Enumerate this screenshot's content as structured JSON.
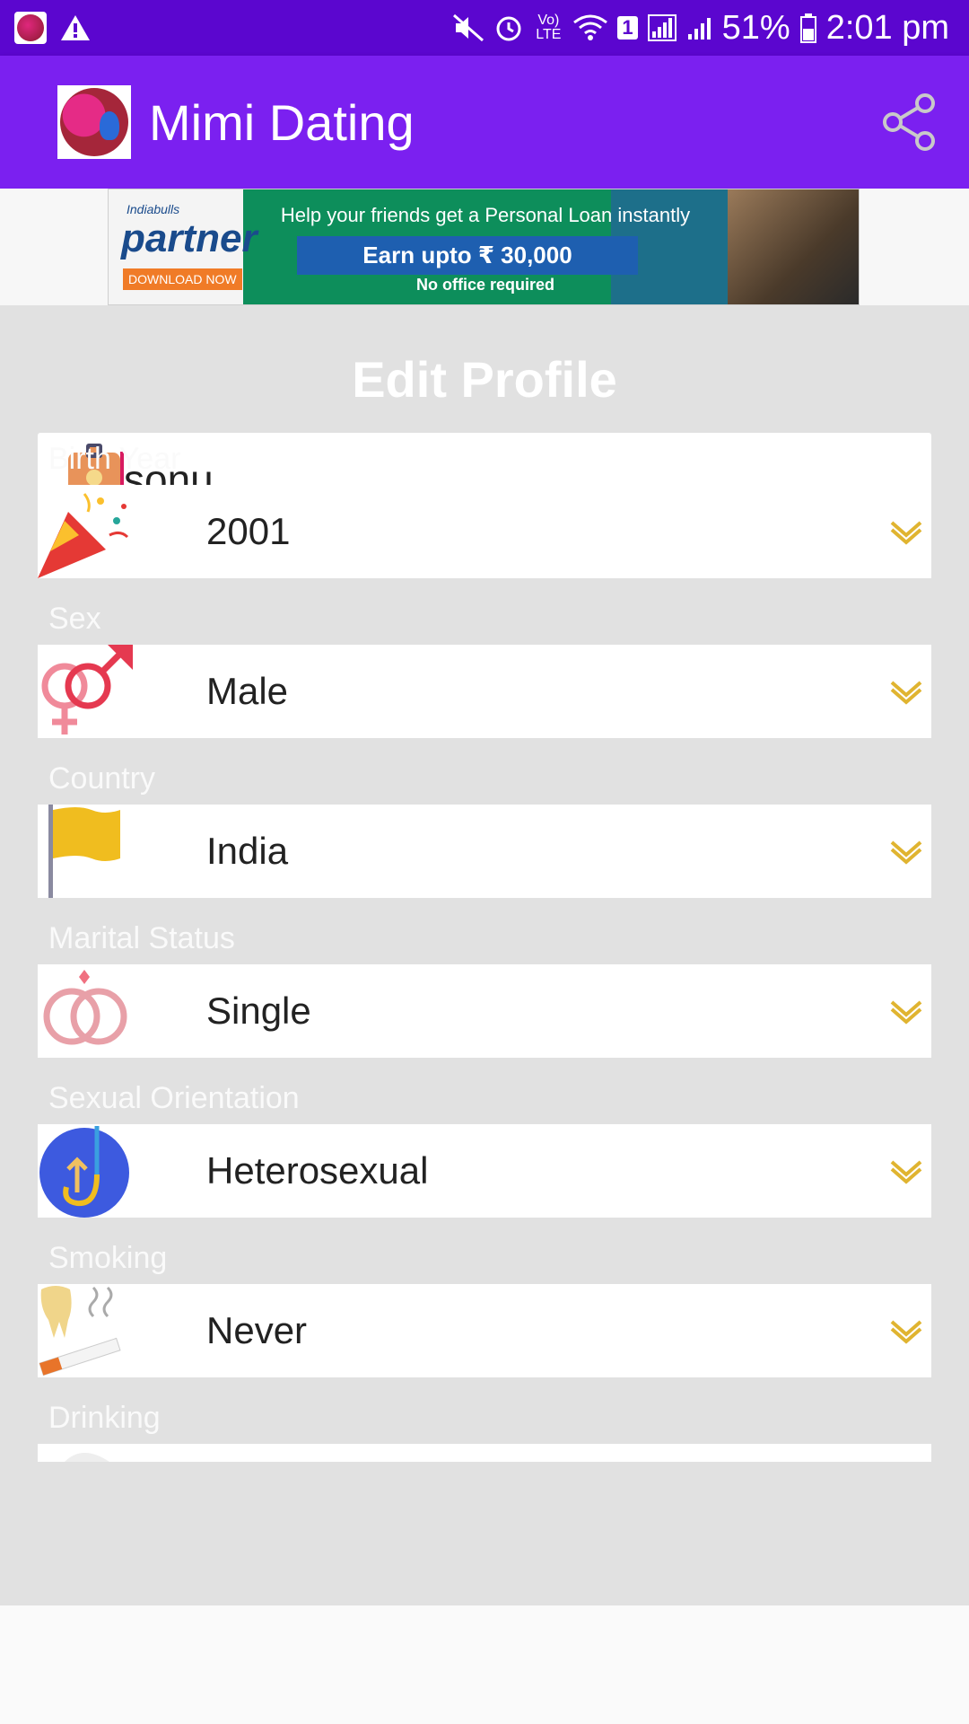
{
  "status_bar": {
    "battery": "51%",
    "time": "2:01 pm",
    "volte": "Vo) LTE",
    "sim": "1"
  },
  "app_bar": {
    "title": "Mimi Dating"
  },
  "ad": {
    "brand_small": "Indiabulls",
    "brand": "partner",
    "cta": "DOWNLOAD NOW",
    "line1": "Help your friends get a Personal Loan instantly",
    "line2": "Earn upto ₹ 30,000",
    "line3": "No office required"
  },
  "form": {
    "heading": "Edit Profile",
    "name_value": "sonu",
    "fields": [
      {
        "label": "Birth Year",
        "value": "2001",
        "icon": "party-popper-icon"
      },
      {
        "label": "Sex",
        "value": "Male",
        "icon": "gender-icon"
      },
      {
        "label": "Country",
        "value": "India",
        "icon": "flag-icon"
      },
      {
        "label": "Marital Status",
        "value": "Single",
        "icon": "rings-icon"
      },
      {
        "label": "Sexual Orientation",
        "value": "Heterosexual",
        "icon": "orientation-icon"
      },
      {
        "label": "Smoking",
        "value": "Never",
        "icon": "smoking-icon"
      },
      {
        "label": "Drinking",
        "value": "",
        "icon": "drink-icon"
      }
    ]
  },
  "colors": {
    "status_bar": "#5b06cf",
    "app_bar": "#7b20f0",
    "form_bg": "#e1e1e1",
    "chevron": "#e0b430"
  }
}
